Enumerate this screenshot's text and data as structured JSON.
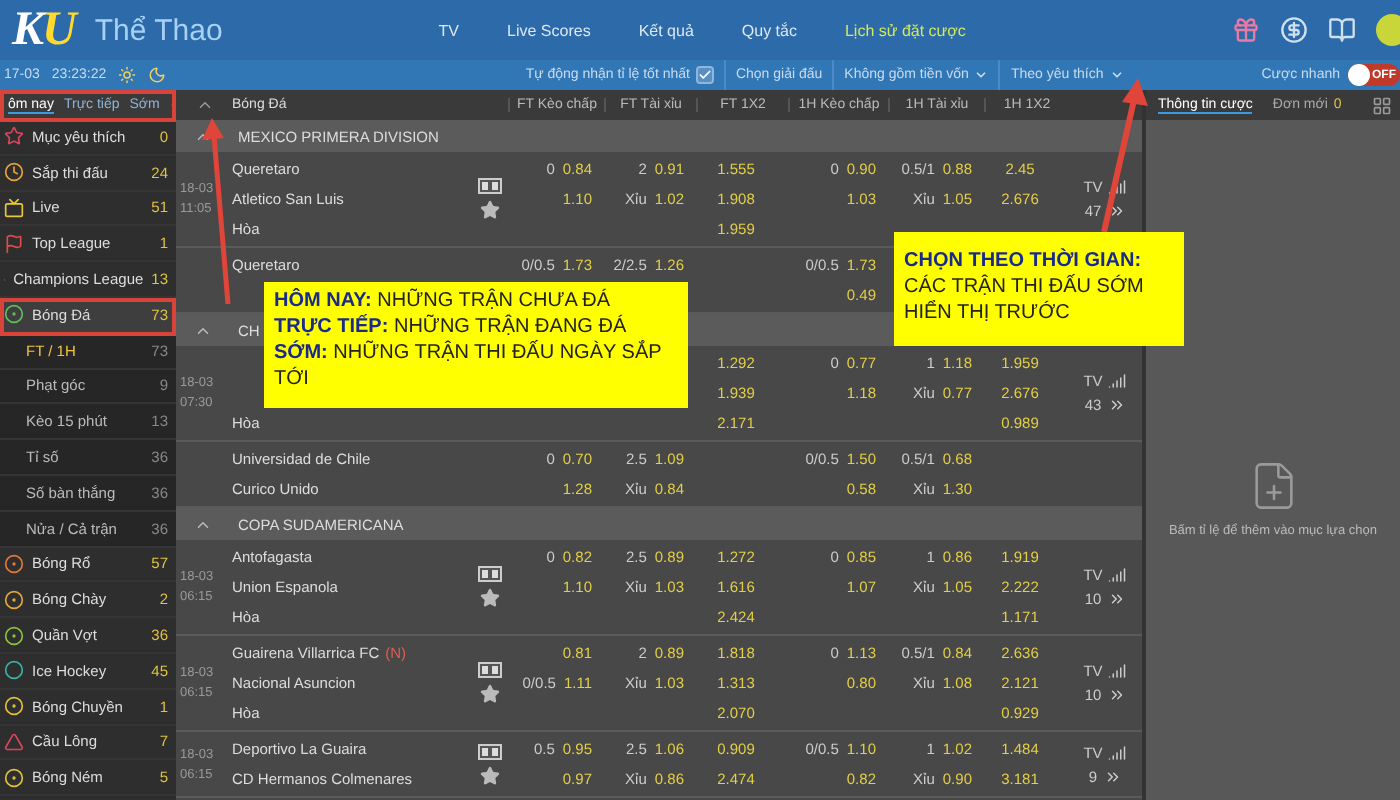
{
  "header": {
    "logo": "KU",
    "title": "Thể Thao",
    "nav": [
      {
        "label": "TV",
        "selected": false
      },
      {
        "label": "Live Scores",
        "selected": false
      },
      {
        "label": "Kết quả",
        "selected": false
      },
      {
        "label": "Quy tắc",
        "selected": false
      },
      {
        "label": "Lịch sử đặt cược",
        "selected": true
      }
    ]
  },
  "toolbar": {
    "date": "17-03",
    "clock": "23:23:22",
    "auto_best_odds": {
      "label": "Tự động nhận tỉ lệ tốt nhất",
      "checked": true
    },
    "filters": [
      {
        "label": "Chọn giải đấu",
        "dropdown": false
      },
      {
        "label": "Không gồm tiền vốn",
        "dropdown": true
      },
      {
        "label": "Theo yêu thích",
        "dropdown": true
      }
    ],
    "quick_bet": {
      "label": "Cược nhanh",
      "on": false,
      "state_label": "OFF"
    }
  },
  "sidebar": {
    "tabs": [
      {
        "label": "ôm nay",
        "selected": true
      },
      {
        "label": "Trực tiếp",
        "selected": false
      },
      {
        "label": "Sớm",
        "selected": false
      }
    ],
    "items": [
      {
        "label": "Mục yêu thích",
        "count": "0",
        "selected": false
      },
      {
        "label": "Sắp thi đấu",
        "count": "24",
        "selected": false
      },
      {
        "label": "Live",
        "count": "51",
        "selected": false
      },
      {
        "label": "Top League",
        "count": "1",
        "selected": false
      },
      {
        "label": "Champions League",
        "count": "13",
        "selected": false
      },
      {
        "label": "Bóng Đá",
        "count": "73",
        "selected": true,
        "children": [
          {
            "label": "FT / 1H",
            "count": "73",
            "selected": true
          },
          {
            "label": "Phạt góc",
            "count": "9",
            "selected": false
          },
          {
            "label": "Kèo 15 phút",
            "count": "13",
            "selected": false
          },
          {
            "label": "Tỉ số",
            "count": "36",
            "selected": false
          },
          {
            "label": "Số bàn thắng",
            "count": "36",
            "selected": false
          },
          {
            "label": "Nửa / Cả trận",
            "count": "36",
            "selected": false
          }
        ]
      },
      {
        "label": "Bóng Rổ",
        "count": "57",
        "selected": false
      },
      {
        "label": "Bóng Chày",
        "count": "2",
        "selected": false
      },
      {
        "label": "Quần Vợt",
        "count": "36",
        "selected": false
      },
      {
        "label": "Ice Hockey",
        "count": "45",
        "selected": false
      },
      {
        "label": "Bóng Chuyền",
        "count": "1",
        "selected": false
      },
      {
        "label": "Cầu Lông",
        "count": "7",
        "selected": false
      },
      {
        "label": "Bóng Ném",
        "count": "5",
        "selected": false
      }
    ]
  },
  "table": {
    "sport": "Bóng Đá",
    "columns": [
      "FT Kèo chấp",
      "FT Tài xỉu",
      "FT 1X2",
      "1H Kèo chấp",
      "1H Tài xỉu",
      "1H 1X2"
    ],
    "sections": [
      {
        "league": "MEXICO PRIMERA DIVISION",
        "matches": [
          {
            "date": "18-03",
            "time": "11:05",
            "icons": true,
            "tv": {
              "label": "TV",
              "count": "47"
            },
            "lines": [
              {
                "team": "Queretaro",
                "cells": [
                  {
                    "line": "0",
                    "odds": "0.84"
                  },
                  {
                    "line": "2",
                    "odds": "0.91"
                  },
                  {
                    "odds": "1.555"
                  },
                  {
                    "line": "0",
                    "odds": "0.90"
                  },
                  {
                    "line": "0.5/1",
                    "odds": "0.88"
                  },
                  {
                    "odds": "2.45"
                  }
                ]
              },
              {
                "team": "Atletico San Luis",
                "cells": [
                  {
                    "odds": "1.10"
                  },
                  {
                    "line": "Xỉu",
                    "odds": "1.02"
                  },
                  {
                    "odds": "1.908"
                  },
                  {
                    "odds": "1.03"
                  },
                  {
                    "line": "Xỉu",
                    "odds": "1.05"
                  },
                  {
                    "odds": "2.676"
                  }
                ]
              },
              {
                "team": "Hòa",
                "cells": [
                  null,
                  null,
                  {
                    "odds": "1.959"
                  },
                  null,
                  null,
                  null
                ]
              }
            ]
          },
          {
            "lines": [
              {
                "team": "Queretaro",
                "cells": [
                  {
                    "line": "0/0.5",
                    "odds": "1.73"
                  },
                  {
                    "line": "2/2.5",
                    "odds": "1.26"
                  },
                  null,
                  {
                    "line": "0/0.5",
                    "odds": "1.73"
                  },
                  null,
                  null
                ]
              },
              {
                "cells": [
                  null,
                  null,
                  null,
                  {
                    "odds": "0.49"
                  },
                  null,
                  null
                ]
              }
            ]
          }
        ]
      },
      {
        "league": "CH",
        "matches": [
          {
            "date": "18-03",
            "time": "07:30",
            "icons": false,
            "tv": {
              "label": "TV",
              "count": "43"
            },
            "lines": [
              {
                "cells": [
                  null,
                  null,
                  {
                    "odds": "1.292"
                  },
                  {
                    "line": "0",
                    "odds": "0.77"
                  },
                  {
                    "line": "1",
                    "odds": "1.18"
                  },
                  {
                    "odds": "1.959"
                  }
                ]
              },
              {
                "cells": [
                  null,
                  null,
                  {
                    "odds": "1.939"
                  },
                  {
                    "odds": "1.18"
                  },
                  {
                    "line": "Xỉu",
                    "odds": "0.77"
                  },
                  {
                    "odds": "2.676"
                  }
                ]
              },
              {
                "team": "Hòa",
                "cells": [
                  null,
                  null,
                  {
                    "odds": "2.171"
                  },
                  null,
                  null,
                  {
                    "odds": "0.989"
                  }
                ]
              }
            ]
          },
          {
            "lines": [
              {
                "team": "Universidad de Chile",
                "cells": [
                  {
                    "line": "0",
                    "odds": "0.70"
                  },
                  {
                    "line": "2.5",
                    "odds": "1.09"
                  },
                  null,
                  {
                    "line": "0/0.5",
                    "odds": "1.50"
                  },
                  {
                    "line": "0.5/1",
                    "odds": "0.68"
                  },
                  null
                ]
              },
              {
                "team": "Curico Unido",
                "cells": [
                  {
                    "odds": "1.28"
                  },
                  {
                    "line": "Xỉu",
                    "odds": "0.84"
                  },
                  null,
                  {
                    "odds": "0.58"
                  },
                  {
                    "line": "Xỉu",
                    "odds": "1.30"
                  },
                  null
                ]
              }
            ]
          }
        ]
      },
      {
        "league": "COPA SUDAMERICANA",
        "matches": [
          {
            "date": "18-03",
            "time": "06:15",
            "icons": true,
            "tv": {
              "label": "TV",
              "count": "10"
            },
            "lines": [
              {
                "team": "Antofagasta",
                "cells": [
                  {
                    "line": "0",
                    "odds": "0.82"
                  },
                  {
                    "line": "2.5",
                    "odds": "0.89"
                  },
                  {
                    "odds": "1.272"
                  },
                  {
                    "line": "0",
                    "odds": "0.85"
                  },
                  {
                    "line": "1",
                    "odds": "0.86"
                  },
                  {
                    "odds": "1.919"
                  }
                ]
              },
              {
                "team": "Union Espanola",
                "cells": [
                  {
                    "odds": "1.10"
                  },
                  {
                    "line": "Xỉu",
                    "odds": "1.03"
                  },
                  {
                    "odds": "1.616"
                  },
                  {
                    "odds": "1.07"
                  },
                  {
                    "line": "Xỉu",
                    "odds": "1.05"
                  },
                  {
                    "odds": "2.222"
                  }
                ]
              },
              {
                "team": "Hòa",
                "cells": [
                  null,
                  null,
                  {
                    "odds": "2.424"
                  },
                  null,
                  null,
                  {
                    "odds": "1.171"
                  }
                ]
              }
            ]
          },
          {
            "date": "18-03",
            "time": "06:15",
            "icons": true,
            "tv": {
              "label": "TV",
              "count": "10"
            },
            "lines": [
              {
                "team": "Guairena Villarrica FC",
                "tag": "(N)",
                "cells": [
                  {
                    "odds": "0.81"
                  },
                  {
                    "line": "2",
                    "odds": "0.89"
                  },
                  {
                    "odds": "1.818"
                  },
                  {
                    "line": "0",
                    "odds": "1.13"
                  },
                  {
                    "line": "0.5/1",
                    "odds": "0.84"
                  },
                  {
                    "odds": "2.636"
                  }
                ]
              },
              {
                "team": "Nacional Asuncion",
                "cells": [
                  {
                    "line": "0/0.5",
                    "odds": "1.11"
                  },
                  {
                    "line": "Xỉu",
                    "odds": "1.03"
                  },
                  {
                    "odds": "1.313"
                  },
                  {
                    "odds": "0.80"
                  },
                  {
                    "line": "Xỉu",
                    "odds": "1.08"
                  },
                  {
                    "odds": "2.121"
                  }
                ]
              },
              {
                "team": "Hòa",
                "cells": [
                  null,
                  null,
                  {
                    "odds": "2.070"
                  },
                  null,
                  null,
                  {
                    "odds": "0.929"
                  }
                ]
              }
            ]
          },
          {
            "date": "18-03",
            "time": "06:15",
            "icons": true,
            "tv": {
              "label": "TV",
              "count": "9"
            },
            "lines": [
              {
                "team": "Deportivo La Guaira",
                "cells": [
                  {
                    "line": "0.5",
                    "odds": "0.95"
                  },
                  {
                    "line": "2.5",
                    "odds": "1.06"
                  },
                  {
                    "odds": "0.909"
                  },
                  {
                    "line": "0/0.5",
                    "odds": "1.10"
                  },
                  {
                    "line": "1",
                    "odds": "1.02"
                  },
                  {
                    "odds": "1.484"
                  }
                ]
              },
              {
                "team": "CD Hermanos Colmenares",
                "cells": [
                  {
                    "odds": "0.97"
                  },
                  {
                    "line": "Xỉu",
                    "odds": "0.86"
                  },
                  {
                    "odds": "2.474"
                  },
                  {
                    "odds": "0.82"
                  },
                  {
                    "line": "Xỉu",
                    "odds": "0.90"
                  },
                  {
                    "odds": "3.181"
                  }
                ]
              }
            ]
          }
        ]
      }
    ]
  },
  "bet_panel": {
    "tabs": [
      {
        "label": "Thông tin cược",
        "selected": true
      },
      {
        "label": "Đơn mới",
        "count": "0",
        "selected": false
      }
    ],
    "hint": "Bấm tỉ lệ để thêm vào mục lựa chọn"
  },
  "callouts": [
    {
      "lines": [
        "**HÔM NAY:** NHỮNG TRẬN CHƯA ĐÁ",
        "**TRỰC TIẾP:** NHỮNG TRẬN ĐANG ĐÁ",
        "**SỚM:** NHỮNG TRẬN THI ĐẤU NGÀY SẮP TỚI"
      ]
    },
    {
      "lines": [
        "**CHỌN THEO THỜI GIAN:** CÁC TRẬN THI ĐẤU SỚM HIỂN THỊ TRƯỚC"
      ]
    }
  ]
}
